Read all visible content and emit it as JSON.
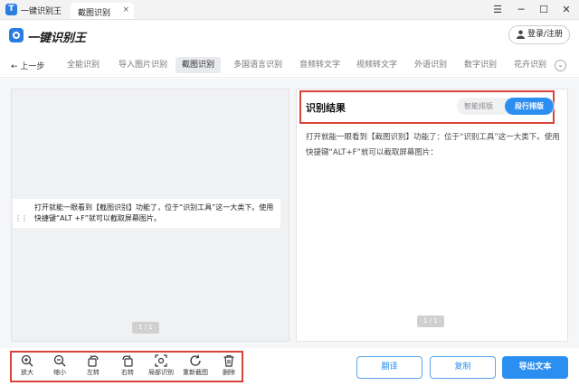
{
  "window": {
    "app_title": "一键识别王",
    "tab_label": "截图识别",
    "tab_close": "×",
    "minimize": "─",
    "maximize": "☐",
    "close": "✕",
    "menu": "☰"
  },
  "header": {
    "brand": "一键识别王",
    "login": "登录/注册"
  },
  "nav": {
    "back": "← 上一步",
    "items": [
      "全能识别",
      "导入图片识别",
      "截图识别",
      "多国语言识别",
      "音频转文字",
      "视频转文字",
      "外语识别",
      "数字识别",
      "花卉识别"
    ],
    "active_index": 2,
    "more": "⌄"
  },
  "preview": {
    "text": "打开就能一眼看到【截图识别】功能了，位于“识别工具”这一大类下。使用快捷键“ALT +F”就可以截取屏幕图片。",
    "handle": "⋮⋮",
    "page": "1 / 1"
  },
  "result": {
    "title": "识别结果",
    "mode_smart": "智能排版",
    "mode_line": "段行排版",
    "text": "打开就能一眼看到【截图识别】功能了：位于“识别工具”这一大类下。使用快捷键“ALT+F”就可以截取屏幕图片：",
    "page": "1 / 1"
  },
  "toolbar": {
    "tools": [
      {
        "label": "放大",
        "icon": "zoom-in-icon"
      },
      {
        "label": "缩小",
        "icon": "zoom-out-icon"
      },
      {
        "label": "左转",
        "icon": "rotate-left-icon"
      },
      {
        "label": "右转",
        "icon": "rotate-right-icon"
      },
      {
        "label": "局部识别",
        "icon": "partial-scan-icon"
      },
      {
        "label": "重新截图",
        "icon": "refresh-icon"
      },
      {
        "label": "删除",
        "icon": "trash-icon"
      }
    ],
    "translate": "翻译",
    "copy": "复制",
    "export": "导出文本"
  },
  "colors": {
    "accent": "#2b8ff2",
    "highlight_border": "#d9443a"
  }
}
